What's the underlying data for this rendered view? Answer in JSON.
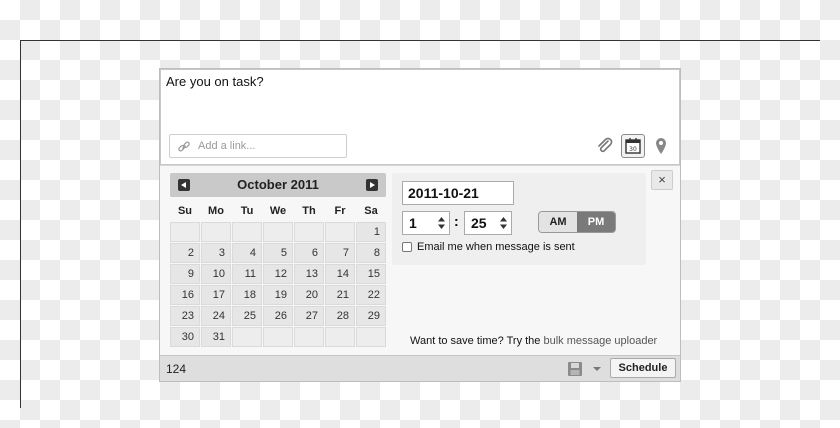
{
  "composer": {
    "message_text": "Are you on task?",
    "link_placeholder": "Add a link..."
  },
  "calendar": {
    "month_title": "October 2011",
    "weekdays": [
      "Su",
      "Mo",
      "Tu",
      "We",
      "Th",
      "Fr",
      "Sa"
    ],
    "leading_blanks": 6,
    "days": [
      "1",
      "2",
      "3",
      "4",
      "5",
      "6",
      "7",
      "8",
      "9",
      "10",
      "11",
      "12",
      "13",
      "14",
      "15",
      "16",
      "17",
      "18",
      "19",
      "20",
      "21",
      "22",
      "23",
      "24",
      "25",
      "26",
      "27",
      "28",
      "29",
      "30",
      "31"
    ],
    "trailing_blanks": 5
  },
  "datetime": {
    "date_value": "2011-10-21",
    "hour": "1",
    "colon": ":",
    "minute": "25",
    "am_label": "AM",
    "pm_label": "PM",
    "email_label": "Email me when message is sent"
  },
  "promo": {
    "text": "Want to save time? Try the ",
    "link_text": "bulk message uploader"
  },
  "footer": {
    "char_count": "124",
    "schedule_label": "Schedule"
  },
  "close_glyph": "×",
  "icons": {
    "link": "chain-link-icon",
    "attachment": "paperclip-icon",
    "schedule": "calendar-icon",
    "location": "map-pin-icon",
    "save": "floppy-disk-icon"
  }
}
